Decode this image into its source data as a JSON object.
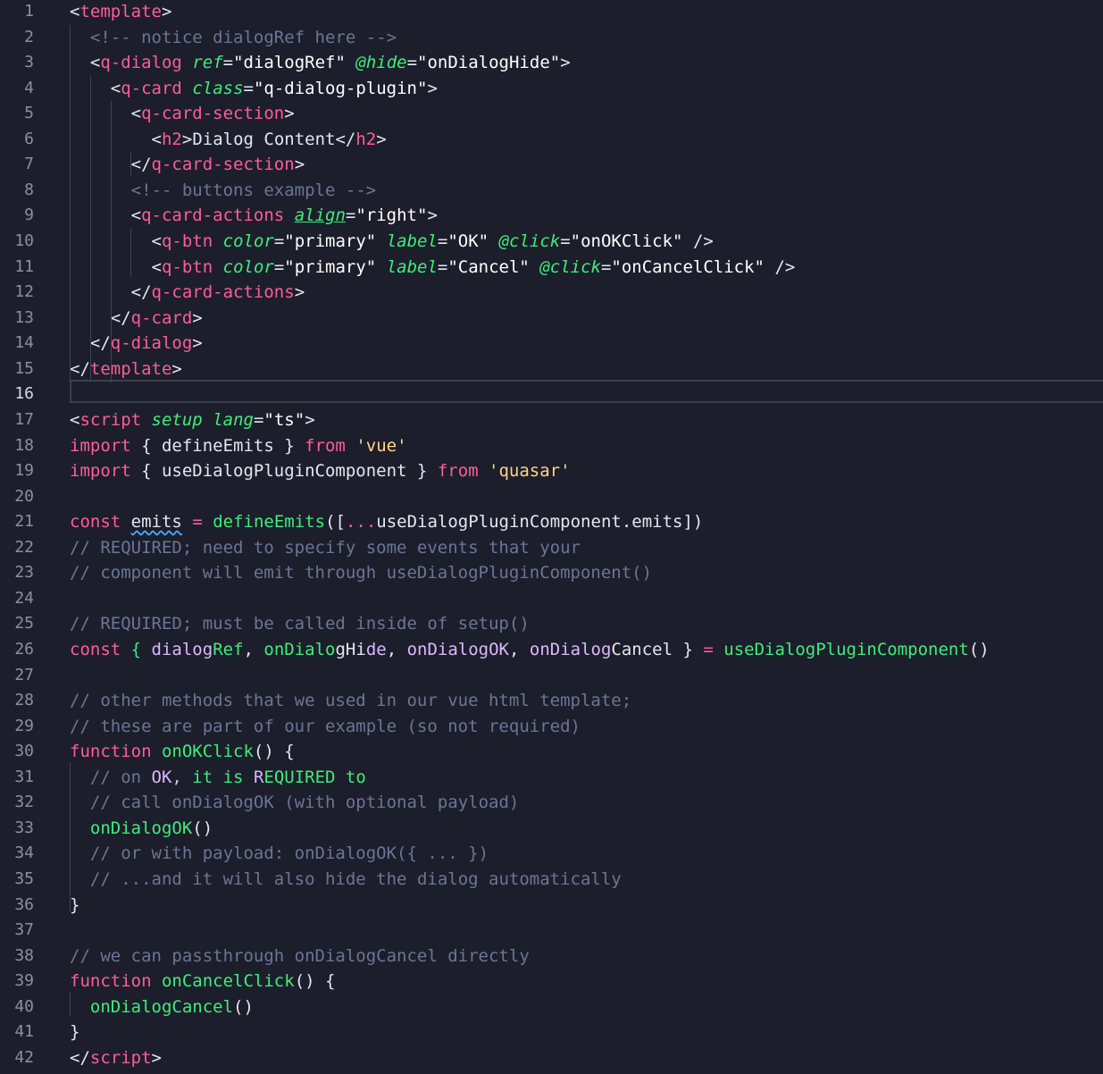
{
  "editor": {
    "language": "vue",
    "current_line": 16,
    "colors": {
      "background": "#1c1e2b",
      "tag": "#ff5c9a",
      "attribute": "#40ec7a",
      "comment": "#6b7596",
      "function": "#40ec7a",
      "variable": "#dcb8ff"
    },
    "lines": [
      {
        "n": "1",
        "tokens": [
          [
            "br",
            "<"
          ],
          [
            "tag",
            "template"
          ],
          [
            "br",
            ">"
          ]
        ]
      },
      {
        "n": "2",
        "tokens": [
          [
            "pl",
            "  "
          ],
          [
            "com",
            "<!-- notice dialogRef here -->"
          ]
        ]
      },
      {
        "n": "3",
        "tokens": [
          [
            "pl",
            "  "
          ],
          [
            "br",
            "<"
          ],
          [
            "tag",
            "q-dialog"
          ],
          [
            "pl",
            " "
          ],
          [
            "attr",
            "ref"
          ],
          [
            "br",
            "="
          ],
          [
            "str",
            "\"dialogRef\""
          ],
          [
            "pl",
            " "
          ],
          [
            "attr",
            "@hide"
          ],
          [
            "br",
            "="
          ],
          [
            "str",
            "\"onDialogHide\""
          ],
          [
            "br",
            ">"
          ]
        ]
      },
      {
        "n": "4",
        "tokens": [
          [
            "pl",
            "    "
          ],
          [
            "br",
            "<"
          ],
          [
            "tag",
            "q-card"
          ],
          [
            "pl",
            " "
          ],
          [
            "attr",
            "class"
          ],
          [
            "br",
            "="
          ],
          [
            "str",
            "\"q-dialog-plugin\""
          ],
          [
            "br",
            ">"
          ]
        ]
      },
      {
        "n": "5",
        "tokens": [
          [
            "pl",
            "      "
          ],
          [
            "br",
            "<"
          ],
          [
            "tag",
            "q-card-section"
          ],
          [
            "br",
            ">"
          ]
        ]
      },
      {
        "n": "6",
        "tokens": [
          [
            "pl",
            "        "
          ],
          [
            "br",
            "<"
          ],
          [
            "tag",
            "h2"
          ],
          [
            "br",
            ">"
          ],
          [
            "pl",
            "Dialog Content"
          ],
          [
            "br",
            "</"
          ],
          [
            "tag",
            "h2"
          ],
          [
            "br",
            ">"
          ]
        ]
      },
      {
        "n": "7",
        "tokens": [
          [
            "pl",
            "      "
          ],
          [
            "br",
            "</"
          ],
          [
            "tag",
            "q-card-section"
          ],
          [
            "br",
            ">"
          ]
        ]
      },
      {
        "n": "8",
        "tokens": [
          [
            "pl",
            "      "
          ],
          [
            "com",
            "<!-- buttons example -->"
          ]
        ]
      },
      {
        "n": "9",
        "tokens": [
          [
            "pl",
            "      "
          ],
          [
            "br",
            "<"
          ],
          [
            "tag",
            "q-card-actions"
          ],
          [
            "pl",
            " "
          ],
          [
            "attr-u",
            "align"
          ],
          [
            "br",
            "="
          ],
          [
            "str",
            "\"right\""
          ],
          [
            "br",
            ">"
          ]
        ]
      },
      {
        "n": "10",
        "tokens": [
          [
            "pl",
            "        "
          ],
          [
            "br",
            "<"
          ],
          [
            "tag",
            "q-btn"
          ],
          [
            "pl",
            " "
          ],
          [
            "attr",
            "color"
          ],
          [
            "br",
            "="
          ],
          [
            "str",
            "\"primary\""
          ],
          [
            "pl",
            " "
          ],
          [
            "attr",
            "label"
          ],
          [
            "br",
            "="
          ],
          [
            "str",
            "\"OK\""
          ],
          [
            "pl",
            " "
          ],
          [
            "attr",
            "@click"
          ],
          [
            "br",
            "="
          ],
          [
            "str",
            "\"onOKClick\""
          ],
          [
            "pl",
            " "
          ],
          [
            "br",
            "/>"
          ]
        ]
      },
      {
        "n": "11",
        "tokens": [
          [
            "pl",
            "        "
          ],
          [
            "br",
            "<"
          ],
          [
            "tag",
            "q-btn"
          ],
          [
            "pl",
            " "
          ],
          [
            "attr",
            "color"
          ],
          [
            "br",
            "="
          ],
          [
            "str",
            "\"primary\""
          ],
          [
            "pl",
            " "
          ],
          [
            "attr",
            "label"
          ],
          [
            "br",
            "="
          ],
          [
            "str",
            "\"Cancel\""
          ],
          [
            "pl",
            " "
          ],
          [
            "attr",
            "@click"
          ],
          [
            "br",
            "="
          ],
          [
            "str",
            "\"onCancelClick\""
          ],
          [
            "pl",
            " "
          ],
          [
            "br",
            "/>"
          ]
        ]
      },
      {
        "n": "12",
        "tokens": [
          [
            "pl",
            "      "
          ],
          [
            "br",
            "</"
          ],
          [
            "tag",
            "q-card-actions"
          ],
          [
            "br",
            ">"
          ]
        ]
      },
      {
        "n": "13",
        "tokens": [
          [
            "pl",
            "    "
          ],
          [
            "br",
            "</"
          ],
          [
            "tag",
            "q-card"
          ],
          [
            "br",
            ">"
          ]
        ]
      },
      {
        "n": "14",
        "tokens": [
          [
            "pl",
            "  "
          ],
          [
            "br",
            "</"
          ],
          [
            "tag",
            "q-dialog"
          ],
          [
            "br",
            ">"
          ]
        ]
      },
      {
        "n": "15",
        "tokens": [
          [
            "br",
            "</"
          ],
          [
            "tag",
            "template"
          ],
          [
            "br",
            ">"
          ]
        ]
      },
      {
        "n": "16",
        "tokens": []
      },
      {
        "n": "17",
        "tokens": [
          [
            "br",
            "<"
          ],
          [
            "tag",
            "script"
          ],
          [
            "pl",
            " "
          ],
          [
            "attr",
            "setup"
          ],
          [
            "pl",
            " "
          ],
          [
            "attr",
            "lang"
          ],
          [
            "br",
            "="
          ],
          [
            "str",
            "\"ts\""
          ],
          [
            "br",
            ">"
          ]
        ]
      },
      {
        "n": "18",
        "tokens": [
          [
            "kw",
            "import"
          ],
          [
            "pl",
            " { defineEmits } "
          ],
          [
            "kw",
            "from"
          ],
          [
            "pl",
            " "
          ],
          [
            "sq",
            "'vue'"
          ]
        ]
      },
      {
        "n": "19",
        "tokens": [
          [
            "kw",
            "import"
          ],
          [
            "pl",
            " { useDialogPluginComponent } "
          ],
          [
            "kw",
            "from"
          ],
          [
            "pl",
            " "
          ],
          [
            "sq",
            "'quasar'"
          ]
        ]
      },
      {
        "n": "20",
        "tokens": []
      },
      {
        "n": "21",
        "tokens": [
          [
            "kw",
            "const"
          ],
          [
            "pl",
            " "
          ],
          [
            "squig",
            "emits"
          ],
          [
            "pl",
            " "
          ],
          [
            "kw",
            "="
          ],
          [
            "pl",
            " "
          ],
          [
            "fn",
            "defineEmits"
          ],
          [
            "pl",
            "(["
          ],
          [
            "kw",
            "..."
          ],
          [
            "pl",
            "useDialogPluginComponent.emits])"
          ]
        ]
      },
      {
        "n": "22",
        "tokens": [
          [
            "com",
            "// REQUIRED; need to specify some events that your"
          ]
        ]
      },
      {
        "n": "23",
        "tokens": [
          [
            "com",
            "// component will emit through useDialogPluginComponent()"
          ]
        ]
      },
      {
        "n": "24",
        "tokens": []
      },
      {
        "n": "25",
        "tokens": [
          [
            "com",
            "// REQUIRED; must be called inside of setup()"
          ]
        ]
      },
      {
        "n": "26",
        "tokens": [
          [
            "kw",
            "const"
          ],
          [
            "pl",
            " "
          ],
          [
            "fn",
            "{ "
          ],
          [
            "var",
            "dialog"
          ],
          [
            "fn",
            "Ref"
          ],
          [
            "pl",
            ", "
          ],
          [
            "fn",
            "onDialo"
          ],
          [
            "pl",
            "gHi"
          ],
          [
            "var",
            "de"
          ],
          [
            "pl",
            ", "
          ],
          [
            "var",
            "onDialogOK"
          ],
          [
            "pl",
            ", "
          ],
          [
            "var",
            "onDialog"
          ],
          [
            "pl",
            "Cancel } "
          ],
          [
            "kw",
            "="
          ],
          [
            "pl",
            " "
          ],
          [
            "fn",
            "useDialogPluginComponent"
          ],
          [
            "pl",
            "()"
          ]
        ]
      },
      {
        "n": "27",
        "tokens": []
      },
      {
        "n": "28",
        "tokens": [
          [
            "com",
            "// other methods that we used in our vue html template;"
          ]
        ]
      },
      {
        "n": "29",
        "tokens": [
          [
            "com",
            "// these are part of our example (so not required)"
          ]
        ]
      },
      {
        "n": "30",
        "tokens": [
          [
            "kw",
            "function"
          ],
          [
            "pl",
            " "
          ],
          [
            "fn",
            "onOKClick"
          ],
          [
            "pl",
            "() {"
          ]
        ]
      },
      {
        "n": "31",
        "tokens": [
          [
            "pl",
            "  "
          ],
          [
            "com",
            "// on "
          ],
          [
            "var",
            "OK, "
          ],
          [
            "fn",
            "it is"
          ],
          [
            "pl",
            " "
          ],
          [
            "var",
            "R"
          ],
          [
            "fn",
            "EQUIRED to"
          ]
        ]
      },
      {
        "n": "32",
        "tokens": [
          [
            "pl",
            "  "
          ],
          [
            "com",
            "// call onDialogOK (with optional payload)"
          ]
        ]
      },
      {
        "n": "33",
        "tokens": [
          [
            "pl",
            "  "
          ],
          [
            "fn",
            "onDialogOK"
          ],
          [
            "pl",
            "()"
          ]
        ]
      },
      {
        "n": "34",
        "tokens": [
          [
            "pl",
            "  "
          ],
          [
            "com",
            "// or with payload: onDialogOK({ ... })"
          ]
        ]
      },
      {
        "n": "35",
        "tokens": [
          [
            "pl",
            "  "
          ],
          [
            "com",
            "// ...and it will also hide the dialog automatically"
          ]
        ]
      },
      {
        "n": "36",
        "tokens": [
          [
            "pl",
            "}"
          ]
        ]
      },
      {
        "n": "37",
        "tokens": []
      },
      {
        "n": "38",
        "tokens": [
          [
            "com",
            "// we can passthrough onDialogCancel directly"
          ]
        ]
      },
      {
        "n": "39",
        "tokens": [
          [
            "kw",
            "function"
          ],
          [
            "pl",
            " "
          ],
          [
            "fn",
            "onCancelClick"
          ],
          [
            "pl",
            "() {"
          ]
        ]
      },
      {
        "n": "40",
        "tokens": [
          [
            "pl",
            "  "
          ],
          [
            "fn",
            "onDialogCancel"
          ],
          [
            "pl",
            "()"
          ]
        ]
      },
      {
        "n": "41",
        "tokens": [
          [
            "pl",
            "}"
          ]
        ]
      },
      {
        "n": "42",
        "tokens": [
          [
            "br",
            "</"
          ],
          [
            "tag",
            "script"
          ],
          [
            "br",
            ">"
          ]
        ]
      }
    ]
  }
}
